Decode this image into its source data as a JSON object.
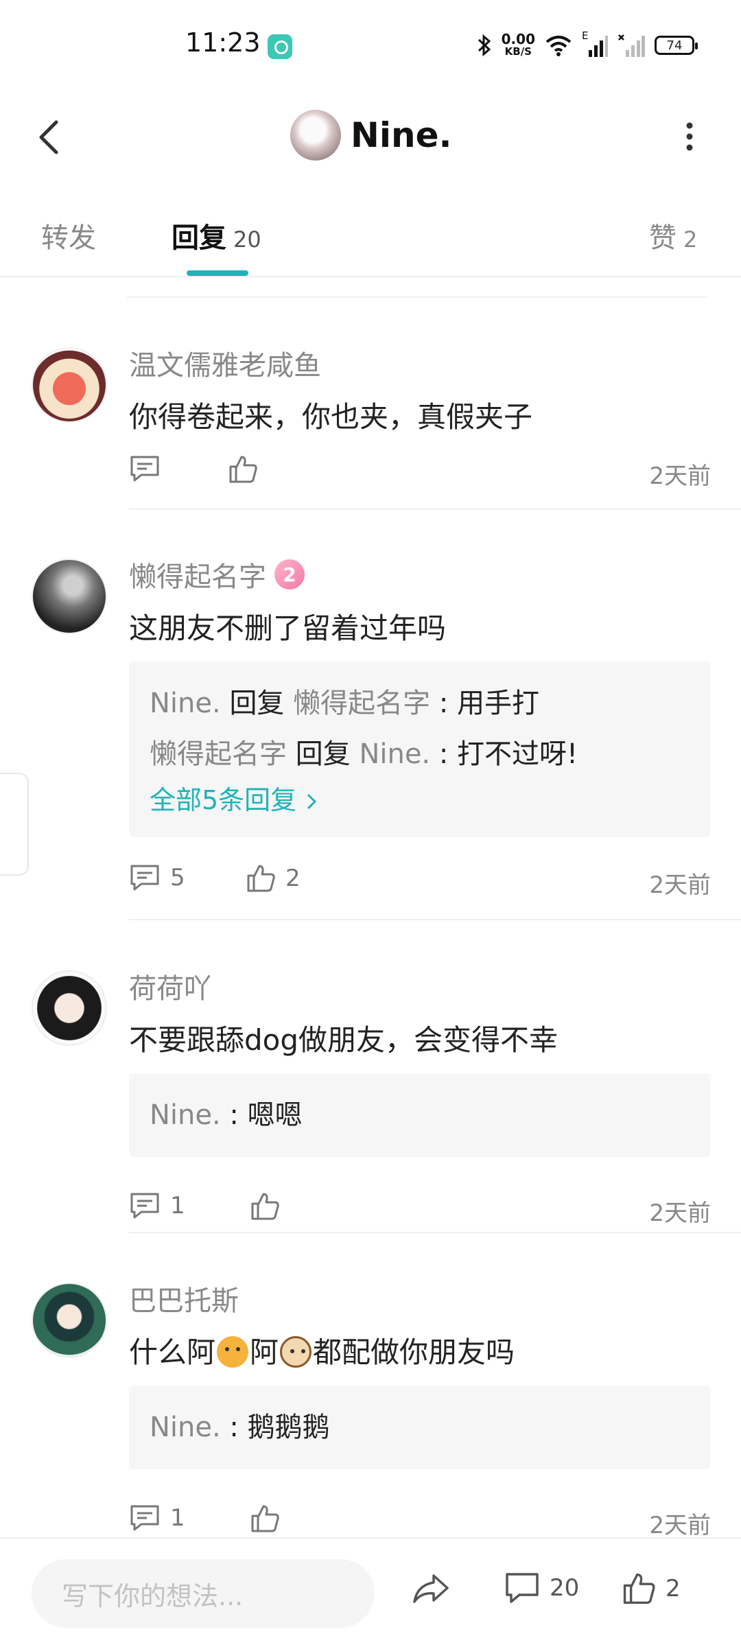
{
  "status_bar": {
    "time": "11:23",
    "net_speed_value": "0.00",
    "net_speed_unit": "KB/S",
    "network_type": "E",
    "battery": "74"
  },
  "header": {
    "title": "Nine.",
    "back_icon": "chevron-left-icon",
    "more_icon": "more-vertical-icon"
  },
  "tabs": [
    {
      "label": "转发",
      "count": ""
    },
    {
      "label": "回复",
      "count": "20",
      "active": true
    },
    {
      "label": "赞",
      "count": "2"
    }
  ],
  "accent_color": "#1fb3b8",
  "comments": [
    {
      "username": "温文儒雅老咸鱼",
      "text": "你得卷起来，你也夹，真假夹子",
      "reply_count": "",
      "like_count": "",
      "time": "2天前"
    },
    {
      "username": "懒得起名字",
      "badge": "2",
      "text": "这朋友不删了留着过年吗",
      "replies": [
        {
          "from": "Nine.",
          "verb": "回复",
          "to": "懒得起名字",
          "sep": " : ",
          "text": "用手打"
        },
        {
          "from": "懒得起名字",
          "verb": "回复",
          "to": "Nine.",
          "sep": " : ",
          "text": "打不过呀!"
        }
      ],
      "more_replies": "全部5条回复",
      "reply_count": "5",
      "like_count": "2",
      "time": "2天前"
    },
    {
      "username": "荷荷吖",
      "text": "不要跟舔dog做朋友，会变得不幸",
      "replies": [
        {
          "from": "Nine.",
          "sep": " : ",
          "text": "嗯嗯"
        }
      ],
      "reply_count": "1",
      "like_count": "",
      "time": "2天前"
    },
    {
      "username": "巴巴托斯",
      "text_parts": [
        "什么阿",
        "阿",
        "都配做你朋友吗"
      ],
      "replies": [
        {
          "from": "Nine.",
          "sep": " : ",
          "text": "鹅鹅鹅"
        }
      ],
      "reply_count": "1",
      "like_count": "",
      "time": "2天前"
    }
  ],
  "bottom_bar": {
    "placeholder": "写下你的想法...",
    "comment_count": "20",
    "like_count": "2"
  }
}
